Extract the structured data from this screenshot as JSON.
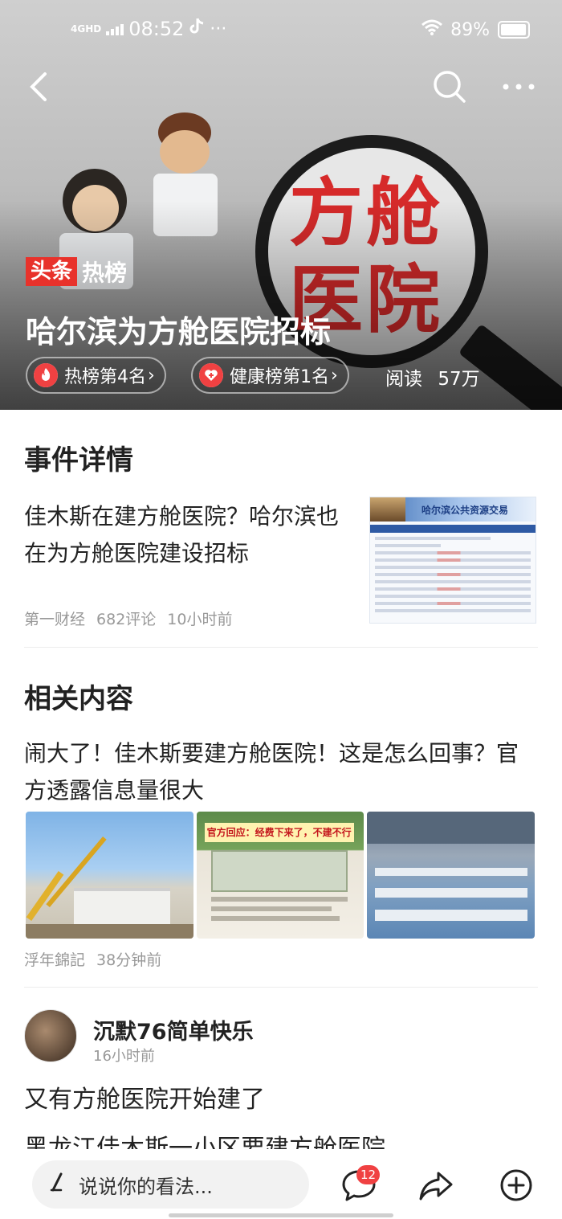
{
  "status_bar": {
    "network": "4GHD",
    "time": "08:52",
    "battery": "89%"
  },
  "hero": {
    "image_text": "方舱医院",
    "brand_box": "头条",
    "brand_text": "热榜",
    "title": "哈尔滨为方舱医院招标",
    "pill_hot": "热榜第4名",
    "pill_health": "健康榜第1名",
    "read_label": "阅读",
    "read_count": "57万"
  },
  "event": {
    "section_title": "事件详情",
    "article_title": "佳木斯在建方舱医院？哈尔滨也在为方舱医院建设招标",
    "source": "第一财经",
    "comments": "682评论",
    "time": "10小时前",
    "thumb_header": "哈尔滨公共资源交易"
  },
  "related": {
    "section_title": "相关内容",
    "article_title": "闹大了！佳木斯要建方舱医院！这是怎么回事？官方透露信息量很大",
    "source": "浮年錦記",
    "time": "38分钟前",
    "photo2_caption": "官方回应：经费下来了，不建不行"
  },
  "post": {
    "user_name": "沉默76简单快乐",
    "time": "16小时前",
    "text": "又有方舱医院开始建了",
    "text2": "黑龙江佳木斯一小区要建方舱医院"
  },
  "bottom_bar": {
    "comment_placeholder": "说说你的看法...",
    "comment_badge": "12"
  }
}
